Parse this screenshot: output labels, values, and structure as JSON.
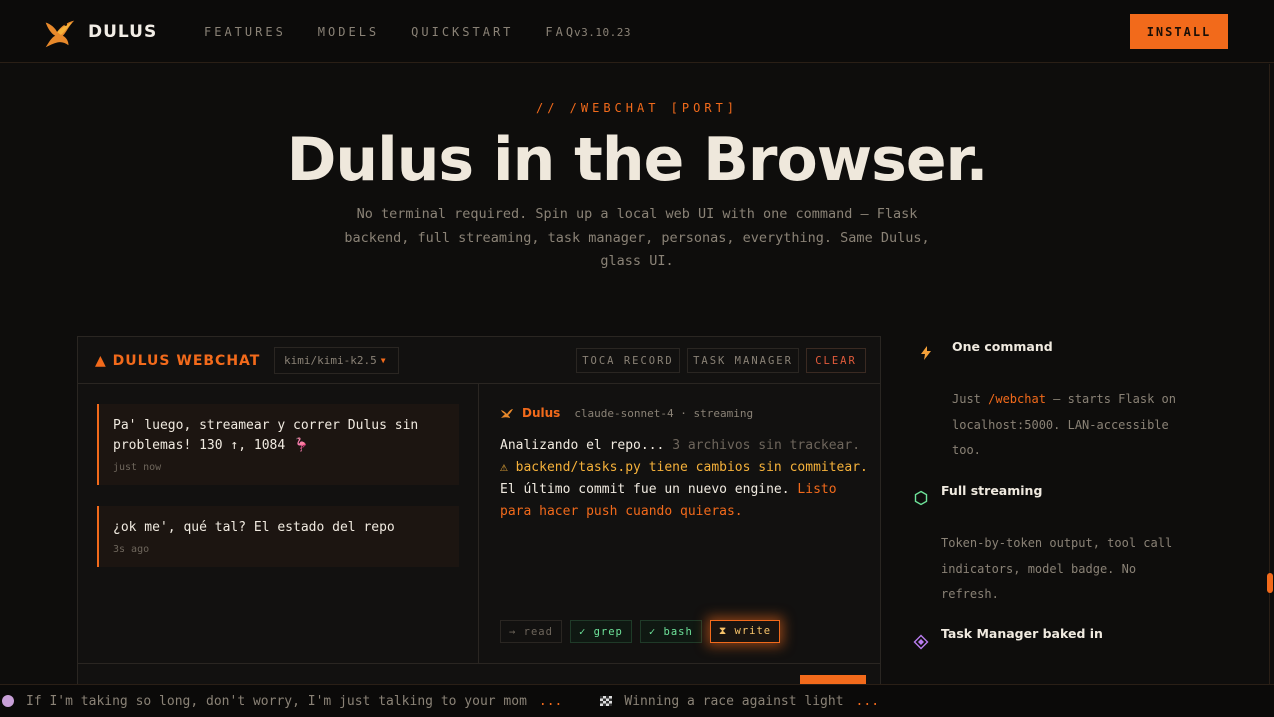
{
  "nav": {
    "brand": "DULUS",
    "links": [
      "FEATURES",
      "MODELS",
      "QUICKSTART",
      "FAQ"
    ],
    "version": "v3.10.23",
    "install_label": "INSTALL"
  },
  "hero": {
    "kicker": "// /WEBCHAT [PORT]",
    "title": "Dulus in the Browser.",
    "subtitle": "No terminal required. Spin up a local web UI with one command — Flask backend, full streaming, task manager, personas, everything. Same Dulus, glass UI."
  },
  "webchat": {
    "title": "▲ DULUS WEBCHAT",
    "model": "kimi/kimi-k2.5",
    "buttons": {
      "record": "TOCA RECORD",
      "task_manager": "TASK MANAGER",
      "clear": "CLEAR"
    },
    "messages": [
      {
        "text": "Pa' luego, streamear y correr Dulus sin problemas! 130 ↑, 1084 🦩",
        "time": "just now"
      },
      {
        "text": "¿ok me', qué tal? El estado del repo",
        "time": "3s ago"
      }
    ],
    "response": {
      "name": "Dulus",
      "meta": "claude-sonnet-4 · streaming",
      "part1": "Analizando el repo...",
      "part2": " 3 archivos sin trackear.",
      "part3": "⚠ backend/tasks.py tiene cambios sin commitear.",
      "part4": " El último commit fue un nuevo engine. ",
      "part5": "Listo para hacer push cuando quieras."
    },
    "tools": [
      {
        "label": "→ read",
        "state": "pending"
      },
      {
        "label": "✓ grep",
        "state": "done"
      },
      {
        "label": "✓ bash",
        "state": "done"
      },
      {
        "label": "⧗ write",
        "state": "active"
      }
    ]
  },
  "features": [
    {
      "icon": "lightning-icon",
      "title": "One command",
      "desc_pre": "Just ",
      "desc_cmd": "/webchat",
      "desc_post": " — starts Flask on localhost:5000. LAN-accessible too."
    },
    {
      "icon": "hexagon-icon",
      "title": "Full streaming",
      "desc": "Token-by-token output, tool call indicators, model badge. No refresh."
    },
    {
      "icon": "diamond-icon",
      "title": "Task Manager baked in",
      "desc": ""
    }
  ],
  "ticker": [
    {
      "icon": "face-icon",
      "text": "If I'm taking so long, don't worry, I'm just talking to your mom",
      "dots": "..."
    },
    {
      "icon": "checkered-flag-icon",
      "text": "Winning a race against light",
      "dots": "..."
    }
  ],
  "colors": {
    "accent": "#f26a1b",
    "background": "#0e0d0c",
    "success": "#6ee39a",
    "warning": "#f5b13a"
  }
}
